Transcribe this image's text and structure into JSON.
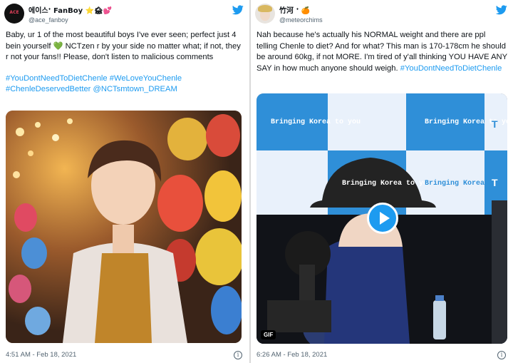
{
  "tweets": [
    {
      "display_name": "에이스ᐩ FanBoy ⭐🏚💕",
      "handle": "@ace_fanboy",
      "text_1": "Baby, ur 1 of the most beautiful boys I've ever seen; perfect just 4 bein yourself ",
      "heart": "💚",
      "text_2": " NCTzen r by your side no matter what; if not, they r not your fans!! Please, don't listen to malicious comments",
      "hashtags": "#YouDontNeedToDietChenle #WeLoveYouChenle #ChenleDeservedBetter @NCTsmtown_DREAM",
      "timestamp": "4:51 AM - Feb 18, 2021",
      "avatar_text": "ACE"
    },
    {
      "display_name": "竹河 ᐩ 🍊",
      "handle": "@meteorchims",
      "text": "Nah because he's actually his NORMAL weight and there are ppl telling Chenle to diet? And for what? This man is 170-178cm he should be around 60kg, if not MORE. I'm tired of y'all thinking YOU HAVE ANY SAY in how much anyone should weigh. ",
      "hashtag": "#YouDontNeedToDietChenle",
      "backdrop_text": "Bringing Korea to you",
      "backdrop_letter": "T",
      "gif_label": "GIF",
      "timestamp": "6:26 AM - Feb 18, 2021"
    }
  ],
  "colors": {
    "link": "#1d9bf0",
    "muted": "#536471",
    "twitter_blue": "#1d9bf0"
  },
  "icons": {
    "brand": "twitter-bird-icon",
    "info": "info-icon",
    "play": "play-icon"
  }
}
